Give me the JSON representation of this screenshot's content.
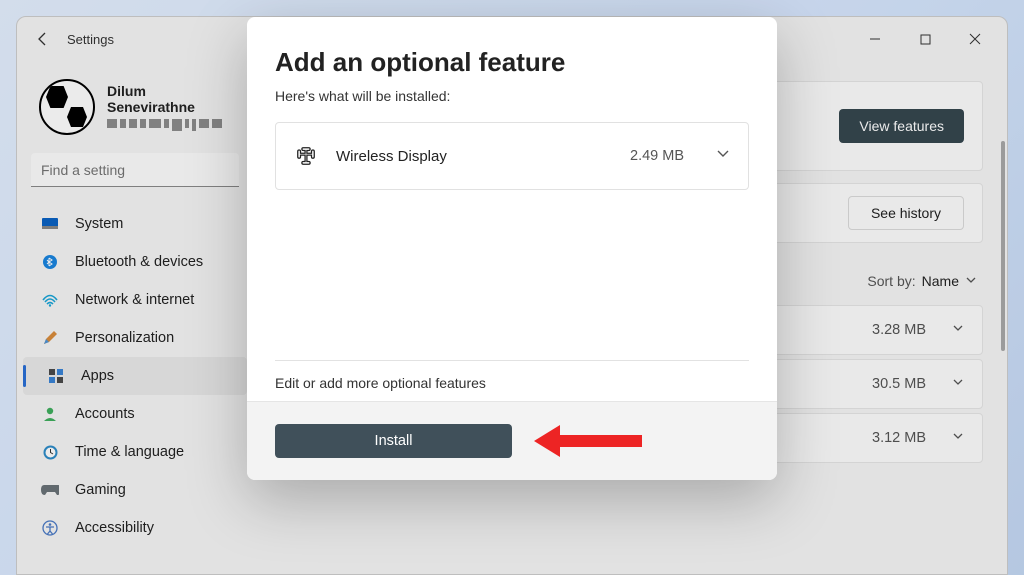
{
  "window": {
    "title": "Settings"
  },
  "profile": {
    "name": "Dilum Senevirathne"
  },
  "search": {
    "placeholder": "Find a setting"
  },
  "nav": {
    "system": "System",
    "bluetooth": "Bluetooth & devices",
    "network": "Network & internet",
    "personalization": "Personalization",
    "apps": "Apps",
    "accounts": "Accounts",
    "time": "Time & language",
    "gaming": "Gaming",
    "accessibility": "Accessibility"
  },
  "main": {
    "view_features": "View features",
    "see_history": "See history",
    "sort_label": "Sort by:",
    "sort_value": "Name",
    "rows": [
      "3.28 MB",
      "30.5 MB",
      "3.12 MB"
    ]
  },
  "dialog": {
    "title": "Add an optional feature",
    "subtitle": "Here's what will be installed:",
    "feature_name": "Wireless Display",
    "feature_size": "2.49 MB",
    "edit_link": "Edit or add more optional features",
    "install": "Install"
  }
}
